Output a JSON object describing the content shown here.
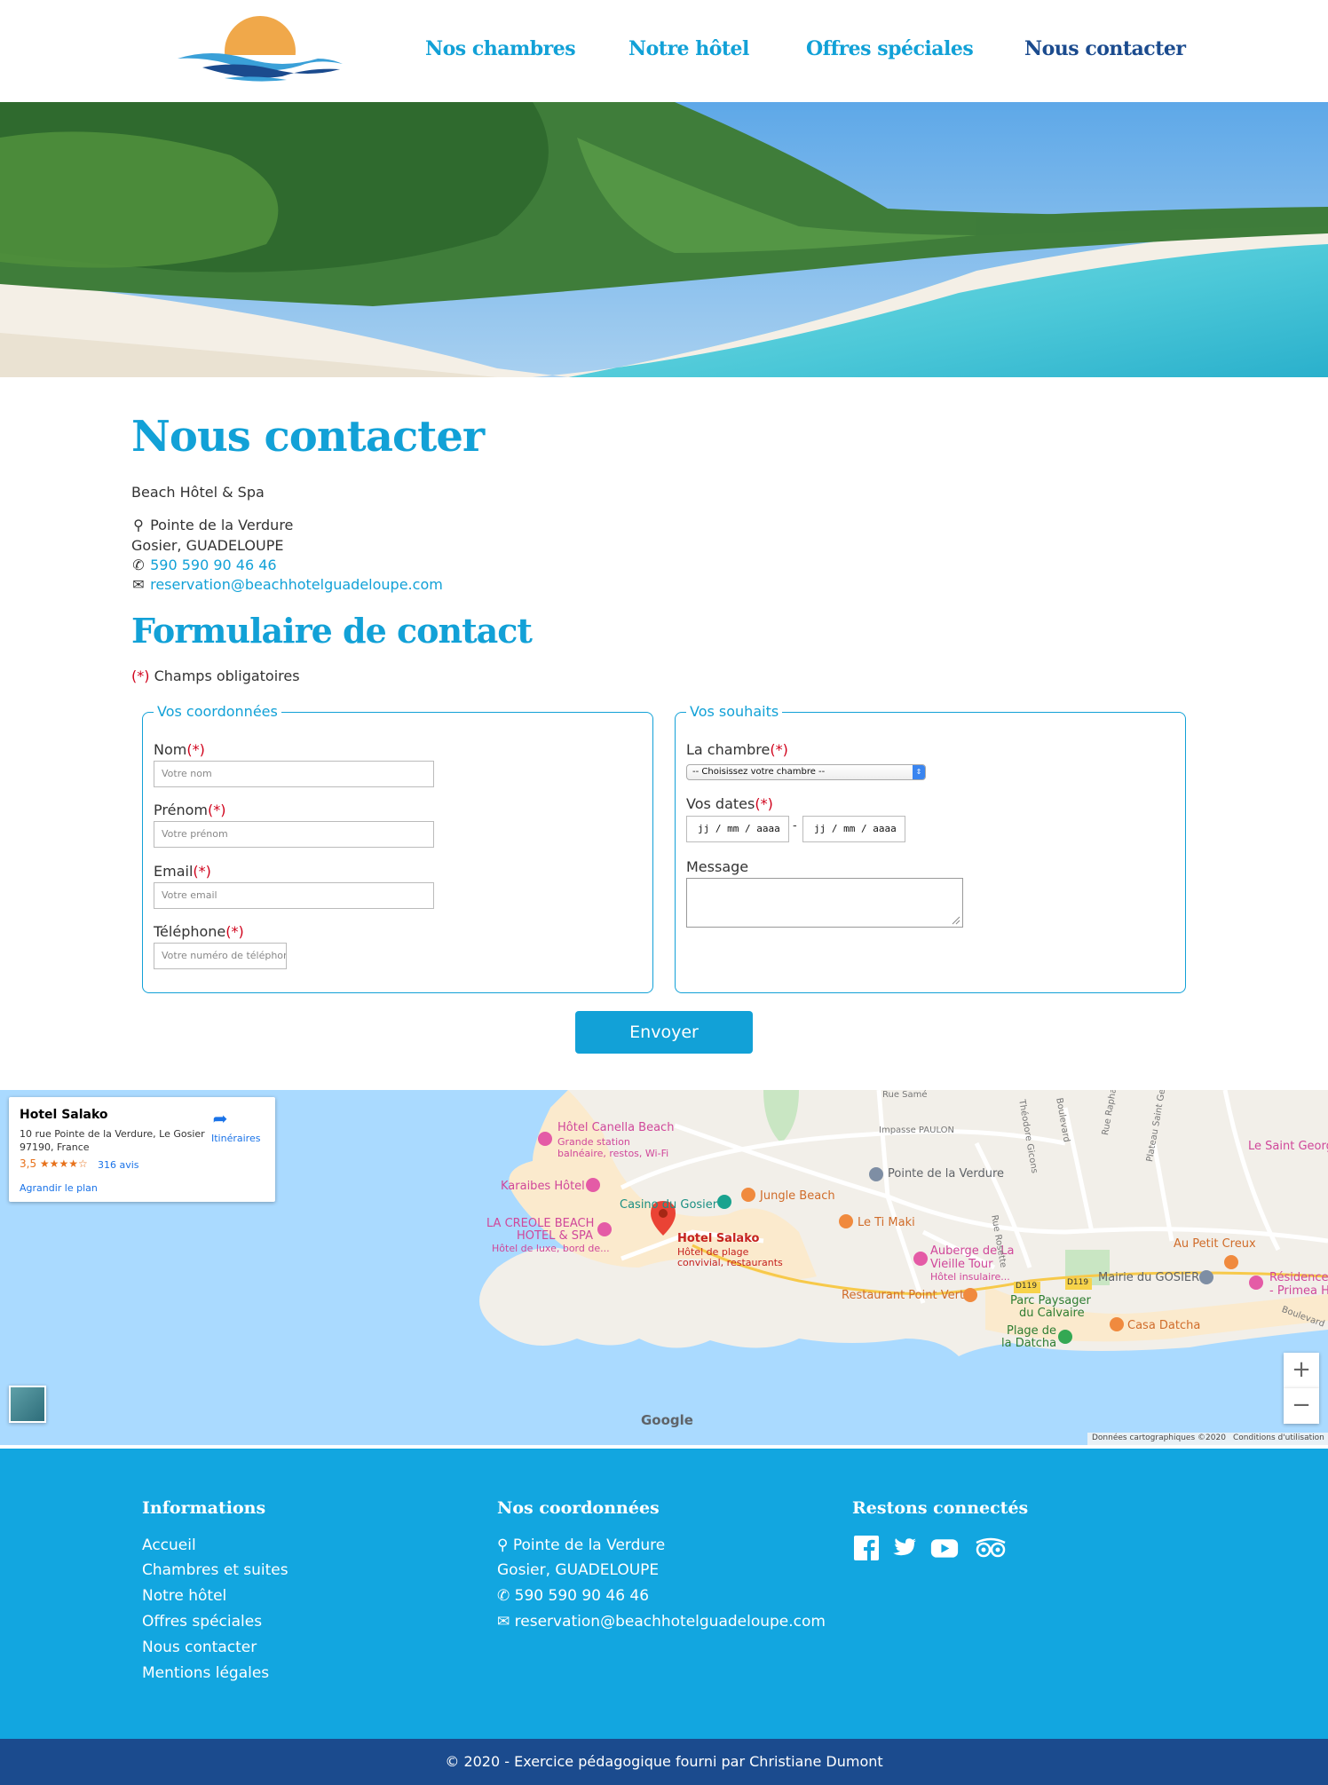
{
  "nav": {
    "rooms": "Nos chambres",
    "hotel": "Notre hôtel",
    "offers": "Offres spéciales",
    "contact": "Nous contacter"
  },
  "page": {
    "title": "Nous contacter",
    "hotel_name": "Beach Hôtel & Spa",
    "address_line1": "Pointe de la Verdure",
    "address_line2": "Gosier, GUADELOUPE",
    "phone": "590 590 90 46 46",
    "email": "reservation@beachhotelguadeloupe.com",
    "form_title": "Formulaire de contact",
    "required_mark": "(*)",
    "required_note": "Champs obligatoires"
  },
  "form": {
    "coords_legend": "Vos coordonnées",
    "wishes_legend": "Vos souhaits",
    "nom_label": "Nom",
    "nom_placeholder": "Votre nom",
    "prenom_label": "Prénom",
    "prenom_placeholder": "Votre prénom",
    "email_label": "Email",
    "email_placeholder": "Votre email",
    "tel_label": "Téléphone",
    "tel_placeholder": "Votre numéro de téléphor",
    "room_label": "La chambre",
    "room_selected": "-- Choisissez votre chambre --",
    "dates_label": "Vos dates",
    "date_placeholder": "jj / mm / aaaa",
    "date_sep": "-",
    "message_label": "Message",
    "submit": "Envoyer"
  },
  "map": {
    "place_name": "Hotel Salako",
    "address_1": "10 rue Pointe de la Verdure, Le Gosier",
    "address_2": "97190, France",
    "rating": "3,5",
    "stars": "★★★★☆",
    "reviews": "316 avis",
    "directions": "Itinéraires",
    "enlarge": "Agrandir le plan",
    "google": "Google",
    "map_data": "Données cartographiques ©2020",
    "terms": "Conditions d'utilisation",
    "zoom_in": "+",
    "zoom_out": "−",
    "labels": {
      "canella": "Hôtel Canella Beach",
      "canella_sub1": "Grande station",
      "canella_sub2": "balnéaire, restos, Wi-Fi",
      "karaibes": "Karaibes Hôtel",
      "casino": "Casino du Gosier",
      "jungle": "Jungle Beach",
      "creole1": "LA CREOLE BEACH",
      "creole2": "HOTEL & SPA",
      "creole_sub": "Hôtel de luxe, bord de...",
      "salako": "Hotel Salako",
      "salako_sub1": "Hôtel de plage",
      "salako_sub2": "convivial, restaurants",
      "verdure": "Pointe de la Verdure",
      "timaki": "Le Ti Maki",
      "auberge1": "Auberge de La",
      "auberge2": "Vieille Tour",
      "auberge_sub": "Hôtel insulaire...",
      "pointvert": "Restaurant Point Vert",
      "parc1": "Parc Paysager",
      "parc2": "du Calvaire",
      "plage1": "Plage de",
      "plage2": "la Datcha",
      "casa": "Casa Datcha",
      "mairie": "Mairie du GOSIER",
      "creux": "Au Petit Creux",
      "residence1": "Résidence",
      "residence2": "- Primea H",
      "saintgeorg": "Le Saint Georg",
      "ruesame": "Rue Samé",
      "paulon": "Impasse PAULON",
      "d119a": "D119",
      "d119b": "D119",
      "rue_rosette": "Rue Rosette",
      "rue_luce": "Rue Raphaël Luce",
      "plateau": "Plateau Saint Germain",
      "boulevard": "Boulevard",
      "theodore": "Théodore Gicons",
      "bourg": "Boulevard"
    }
  },
  "footer": {
    "info_title": "Informations",
    "info_items": [
      "Accueil",
      "Chambres et suites",
      "Notre hôtel",
      "Offres spéciales",
      "Nous contacter",
      "Mentions légales"
    ],
    "coords_title": "Nos coordonnées",
    "address_line1": "Pointe de la Verdure",
    "address_line2": "Gosier, GUADELOUPE",
    "phone": "590 590 90 46 46",
    "email": "reservation@beachhotelguadeloupe.com",
    "social_title": "Restons connectés",
    "social_icons": [
      "facebook-icon",
      "twitter-icon",
      "youtube-icon",
      "tripadvisor-icon"
    ],
    "copyright": "© 2020 - Exercice pédagogique fourni par Christiane Dumont"
  },
  "colors": {
    "accent": "#12a1d7",
    "nav_active": "#1b4b8e",
    "required": "#d0021b",
    "footer_bg": "#12a6e0",
    "copyright_bg": "#1b4b8e"
  }
}
